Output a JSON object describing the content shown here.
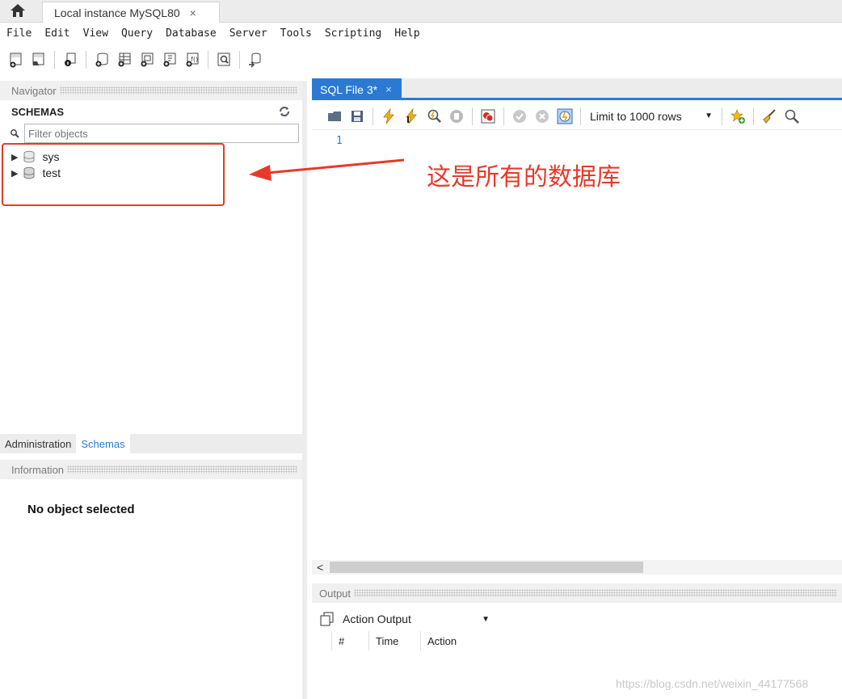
{
  "top_tabs": {
    "connection_title": "Local instance MySQL80",
    "close_glyph": "×"
  },
  "menu": [
    "File",
    "Edit",
    "View",
    "Query",
    "Database",
    "Server",
    "Tools",
    "Scripting",
    "Help"
  ],
  "navigator": {
    "header": "Navigator",
    "schemas_title": "SCHEMAS",
    "filter_placeholder": "Filter objects",
    "schemas": [
      {
        "name": "sys"
      },
      {
        "name": "test"
      }
    ],
    "bottom_tabs": [
      "Administration",
      "Schemas"
    ],
    "active_bottom_tab": "Schemas",
    "information_header": "Information",
    "no_object_text": "No object selected"
  },
  "editor": {
    "tab_title": "SQL File 3*",
    "tab_close": "×",
    "limit_label": "Limit to 1000 rows",
    "line_number": "1"
  },
  "output": {
    "header": "Output",
    "selector_label": "Action Output",
    "columns": [
      "#",
      "Time",
      "Action"
    ]
  },
  "annotation": {
    "text": "这是所有的数据库",
    "color": "#e63a2a"
  },
  "watermark": "https://blog.csdn.net/weixin_44177568",
  "colors": {
    "accent": "#2a7ad4",
    "annotation_red": "#e63a2a"
  },
  "icons": {
    "home": "home-icon",
    "refresh": "refresh-schemas-icon",
    "search": "search-icon",
    "database": "database-icon"
  }
}
